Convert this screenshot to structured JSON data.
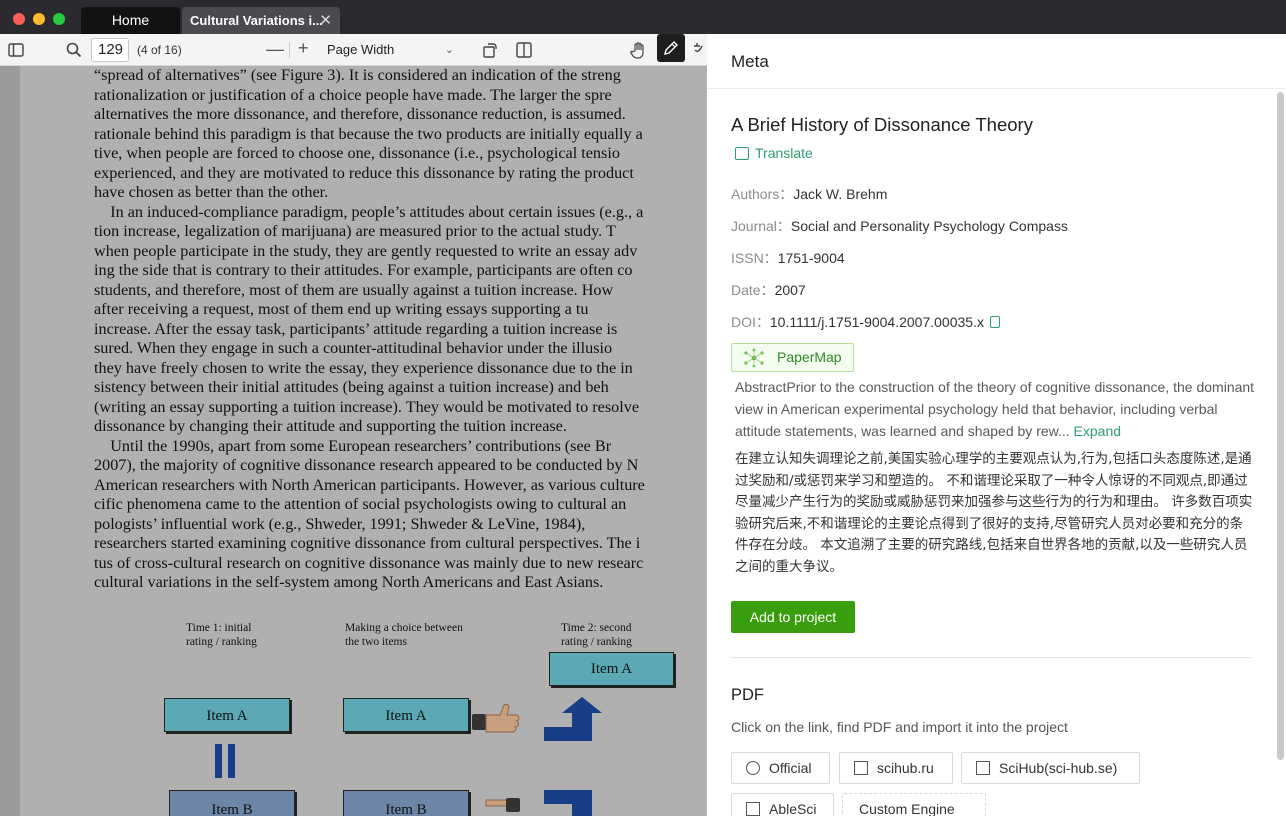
{
  "window": {
    "tabs": [
      {
        "label": "Home"
      },
      {
        "label": "Cultural Variations i..."
      }
    ]
  },
  "pdf_toolbar": {
    "page_value": "129",
    "page_of": "(4 of 16)",
    "zoom_minus": "—",
    "zoom_plus": "+",
    "zoom_mode": "Page Width"
  },
  "pdf_content": {
    "lines": [
      "“spread of alternatives” (see Figure 3). It is considered an indication of the streng",
      "rationalization or justification of a choice people have made. The larger the spre",
      "alternatives the more dissonance, and therefore, dissonance reduction, is assumed.",
      "rationale behind this paradigm is that because the two products are initially equally a",
      "tive, when people are forced to choose one, dissonance (i.e., psychological tensio",
      "experienced, and they are motivated to reduce this dissonance by rating the product",
      "have chosen as better than the other.",
      " In an induced-compliance paradigm, people’s attitudes about certain issues (e.g., a",
      "tion increase, legalization of marijuana) are measured prior to the actual study. T",
      "when people participate in the study, they are gently requested to write an essay adv",
      "ing the side that is contrary to their attitudes. For example, participants are often co",
      "students, and therefore, most of them are usually against a tuition increase. How",
      "after receiving a request, most of them end up writing essays supporting a tu",
      "increase. After the essay task, participants’ attitude regarding a tuition increase is",
      "sured. When they engage in such a counter-attitudinal behavior under the illusio",
      "they have freely chosen to write the essay, they experience dissonance due to the in",
      "sistency between their initial attitudes (being against a tuition increase) and beh",
      "(writing an essay supporting a tuition increase). They would be motivated to resolve",
      "dissonance by changing their attitude and supporting the tuition increase.",
      " Until the 1990s, apart from some European researchers’ contributions (see Br",
      "2007), the majority of cognitive dissonance research appeared to be conducted by N",
      "American researchers with North American participants. However, as various culture",
      "cific phenomena came to the attention of social psychologists owing to cultural an",
      "pologists’ influential work (e.g., Shweder, 1991; Shweder & LeVine, 1984),",
      "researchers started examining cognitive dissonance from cultural perspectives. The i",
      "tus of cross-cultural research on cognitive dissonance was mainly due to new researc",
      "cultural variations in the self-system among North Americans and East Asians."
    ],
    "figure": {
      "label_time1": [
        "Time 1: initial",
        "rating / ranking"
      ],
      "label_choice": [
        "Making a choice between",
        "the two items"
      ],
      "label_time2": [
        "Time 2: second",
        "rating / ranking"
      ],
      "item_a": "Item A",
      "item_b": "Item B"
    }
  },
  "meta": {
    "header": "Meta",
    "title": "A Brief History of Dissonance Theory",
    "translate_label": "Translate",
    "fields": [
      {
        "label": "Authors：",
        "value": "Jack W. Brehm"
      },
      {
        "label": "Journal：",
        "value": "Social and Personality Psychology Compass"
      },
      {
        "label": "ISSN：",
        "value": "1751-9004"
      },
      {
        "label": "Date：",
        "value": "2007"
      },
      {
        "label": "DOI：",
        "value": "10.1111/j.1751-9004.2007.00035.x"
      }
    ],
    "papermap_label": "PaperMap",
    "abstract": "AbstractPrior to the construction of the theory of cognitive dissonance, the dominant view in American experimental psychology held that behavior, including verbal attitude statements, was learned and shaped by rew...",
    "expand_label": "Expand",
    "abstract_zh": "在建立认知失调理论之前,美国实验心理学的主要观点认为,行为,包括口头态度陈述,是通过奖励和/或惩罚来学习和塑造的。 不和谐理论采取了一种令人惊讶的不同观点,即通过尽量减少产生行为的奖励或威胁惩罚来加强参与这些行为的行为和理由。 许多数百项实验研究后来,不和谐理论的主要论点得到了很好的支持,尽管研究人员对必要和充分的条件存在分歧。 本文追溯了主要的研究路线,包括来自世界各地的贡献,以及一些研究人员之间的重大争议。",
    "add_button": "Add to project",
    "pdf_section": {
      "title": "PDF",
      "description": "Click on the link, find PDF and import it into the project",
      "sources": [
        {
          "label": "Official",
          "icon": "globe-icon"
        },
        {
          "label": "scihub.ru",
          "icon": "document-search-icon"
        },
        {
          "label": "SciHub(sci-hub.se)",
          "icon": "document-search-icon"
        },
        {
          "label": "AbleSci",
          "icon": "document-search-icon"
        },
        {
          "label": "Custom Engine",
          "icon": "settings-icon"
        }
      ]
    }
  },
  "colors": {
    "accent_green": "#389e0d",
    "link_green": "#2e9c6e",
    "titlebar": "#2b2b2f"
  }
}
